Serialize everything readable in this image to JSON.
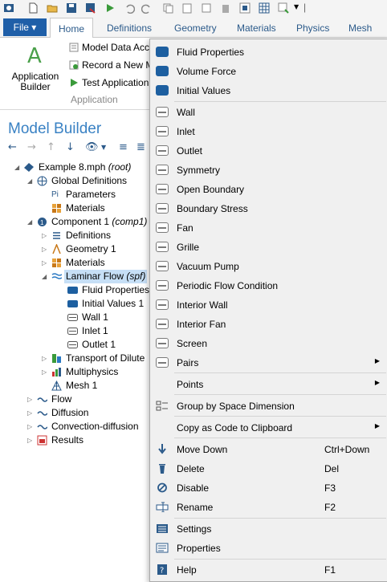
{
  "ribbon_tabs": {
    "file": "File ▾",
    "home": "Home",
    "definitions": "Definitions",
    "geometry": "Geometry",
    "materials": "Materials",
    "physics": "Physics",
    "mesh": "Mesh"
  },
  "ribbon": {
    "app_builder_label": "Application Builder",
    "model_data_access": "Model Data Acc",
    "record_method": "Record a New M",
    "test_application": "Test Application",
    "group_label": "Application"
  },
  "model_builder": {
    "title": "Model Builder"
  },
  "tree": {
    "root": "Example 8.mph",
    "root_suffix": "(root)",
    "global_definitions": "Global Definitions",
    "parameters": "Parameters",
    "global_materials": "Materials",
    "component": "Component 1",
    "component_suffix": "(comp1)",
    "definitions": "Definitions",
    "geometry": "Geometry 1",
    "materials": "Materials",
    "laminar_flow": "Laminar Flow",
    "laminar_flow_suffix": "(spf)",
    "fluid_properties": "Fluid Properties",
    "initial_values": "Initial Values 1",
    "wall": "Wall 1",
    "inlet": "Inlet 1",
    "outlet": "Outlet 1",
    "transport": "Transport of Dilute",
    "multiphysics": "Multiphysics",
    "mesh": "Mesh 1",
    "flow": "Flow",
    "diffusion": "Diffusion",
    "convection_diffusion": "Convection-diffusion",
    "results": "Results"
  },
  "context_menu": {
    "fluid_properties": "Fluid Properties",
    "volume_force": "Volume Force",
    "initial_values": "Initial Values",
    "wall": "Wall",
    "inlet": "Inlet",
    "outlet": "Outlet",
    "symmetry": "Symmetry",
    "open_boundary": "Open Boundary",
    "boundary_stress": "Boundary Stress",
    "fan": "Fan",
    "grille": "Grille",
    "vacuum_pump": "Vacuum Pump",
    "periodic_flow": "Periodic Flow Condition",
    "interior_wall": "Interior Wall",
    "interior_fan": "Interior Fan",
    "screen": "Screen",
    "pairs": "Pairs",
    "points": "Points",
    "group_by_space": "Group by Space Dimension",
    "copy_as_code": "Copy as Code to Clipboard",
    "move_down": "Move Down",
    "move_down_shortcut": "Ctrl+Down",
    "delete": "Delete",
    "delete_shortcut": "Del",
    "disable": "Disable",
    "disable_shortcut": "F3",
    "rename": "Rename",
    "rename_shortcut": "F2",
    "settings": "Settings",
    "properties": "Properties",
    "help": "Help",
    "help_shortcut": "F1"
  },
  "colors": {
    "accent_blue": "#1d5fa0",
    "model_builder_title": "#3a82c4",
    "selection": "#c6dff6"
  }
}
